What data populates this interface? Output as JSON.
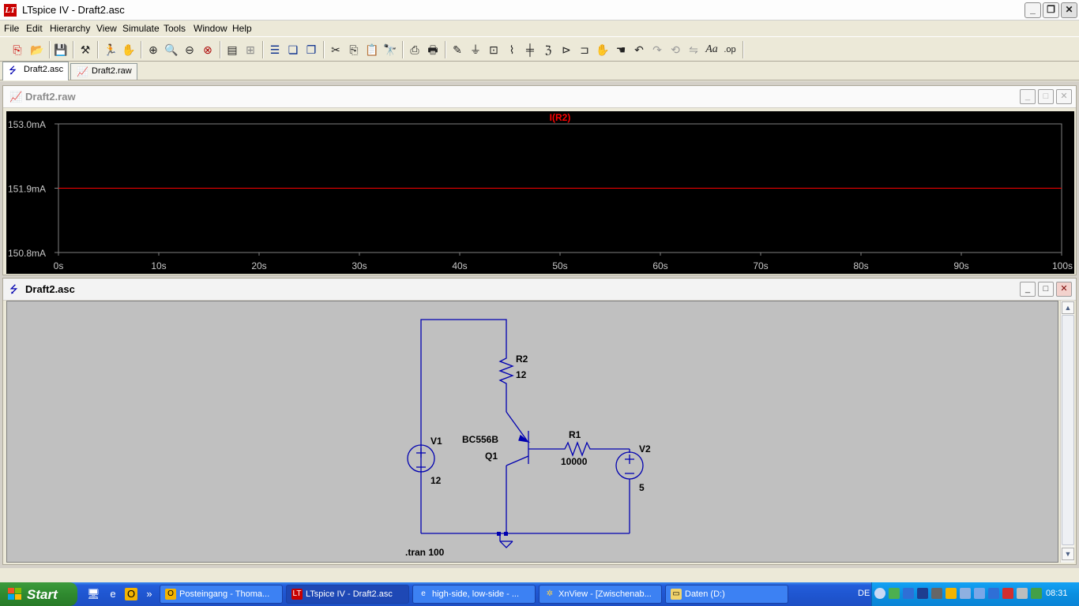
{
  "window": {
    "title": "LTspice IV - Draft2.asc",
    "app_icon": "ltspice-icon"
  },
  "menu": [
    "File",
    "Edit",
    "Hierarchy",
    "View",
    "Simulate",
    "Tools",
    "Window",
    "Help"
  ],
  "toolbar_icons": [
    "new-schematic-icon",
    "open-icon",
    "save-icon",
    "control-panel-icon",
    "run-icon",
    "pan-icon",
    "zoom-in-icon",
    "zoom-out-icon",
    "zoom-area-icon",
    "zoom-cancel-icon",
    "autorange-icon",
    "grid-icon",
    "tile-horizontal-icon",
    "cascade-icon",
    "tile-vertical-icon",
    "cut-icon",
    "copy-icon",
    "paste-icon",
    "find-icon",
    "print-preview-icon",
    "print-icon",
    "draw-wire-icon",
    "ground-icon",
    "label-net-icon",
    "resistor-icon",
    "capacitor-icon",
    "inductor-icon",
    "diode-icon",
    "component-icon",
    "move-icon",
    "drag-icon",
    "undo-icon",
    "redo-icon",
    "rotate-icon",
    "mirror-icon",
    "text-icon",
    "spice-directive-icon"
  ],
  "tabs": [
    {
      "label": "Draft2.asc",
      "active": true
    },
    {
      "label": "Draft2.raw",
      "active": false
    }
  ],
  "plot": {
    "window_title": "Draft2.raw",
    "trace_label": "I(R2)",
    "trace_color": "#ff0000",
    "y_ticks": [
      "153.0mA",
      "151.9mA",
      "150.8mA"
    ],
    "x_ticks": [
      "0s",
      "10s",
      "20s",
      "30s",
      "40s",
      "50s",
      "60s",
      "70s",
      "80s",
      "90s",
      "100s"
    ]
  },
  "chart_data": {
    "type": "line",
    "title": "",
    "xlabel": "",
    "ylabel": "",
    "xlim": [
      0,
      100
    ],
    "ylim": [
      150.8,
      153.0
    ],
    "x_unit": "s",
    "y_unit": "mA",
    "x": [
      0,
      100
    ],
    "series": [
      {
        "name": "I(R2)",
        "values": [
          151.9,
          151.9
        ]
      }
    ]
  },
  "schematic": {
    "window_title": "Draft2.asc",
    "wire_color": "#0000b0",
    "labels": {
      "r2_name": "R2",
      "r2_value": "12",
      "v1_name": "V1",
      "v1_value": "12",
      "q1_model": "BC556B",
      "q1_name": "Q1",
      "r1_name": "R1",
      "r1_value": "10000",
      "v2_name": "V2",
      "v2_value": "5",
      "directive": ".tran 100"
    }
  },
  "taskbar": {
    "start": "Start",
    "tasks": [
      "Posteingang - Thoma...",
      "LTspice IV - Draft2.asc",
      "high-side, low-side - ...",
      "XnView - [Zwischenab...",
      "Daten (D:)"
    ],
    "language": "DE",
    "clock": "08:31"
  }
}
